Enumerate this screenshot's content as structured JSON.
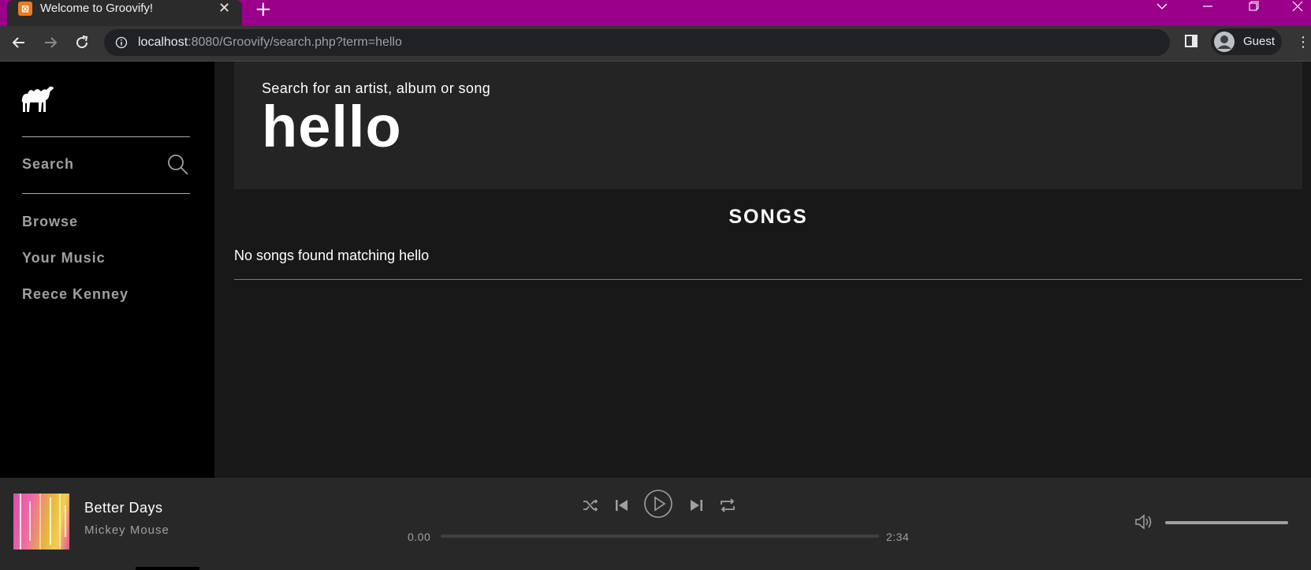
{
  "browser": {
    "tab_title": "Welcome to Groovify!",
    "favicon_glyph": "⊠",
    "url_host": "localhost",
    "url_rest": ":8080/Groovify/search.php?term=hello",
    "profile_label": "Guest",
    "accent": "#9a008a"
  },
  "sidebar": {
    "search_label": "Search",
    "items": [
      {
        "label": "Browse"
      },
      {
        "label": "Your Music"
      },
      {
        "label": "Reece Kenney"
      }
    ]
  },
  "search": {
    "hint": "Search for an artist, album or song",
    "term": "hello"
  },
  "songs_section": {
    "title": "SONGS",
    "empty_message": "No songs found matching hello"
  },
  "player": {
    "track": "Better Days",
    "artist": "Mickey Mouse",
    "current_time": "0.00",
    "total_time": "2:34",
    "progress_fraction": 0,
    "volume_fraction": 1
  }
}
